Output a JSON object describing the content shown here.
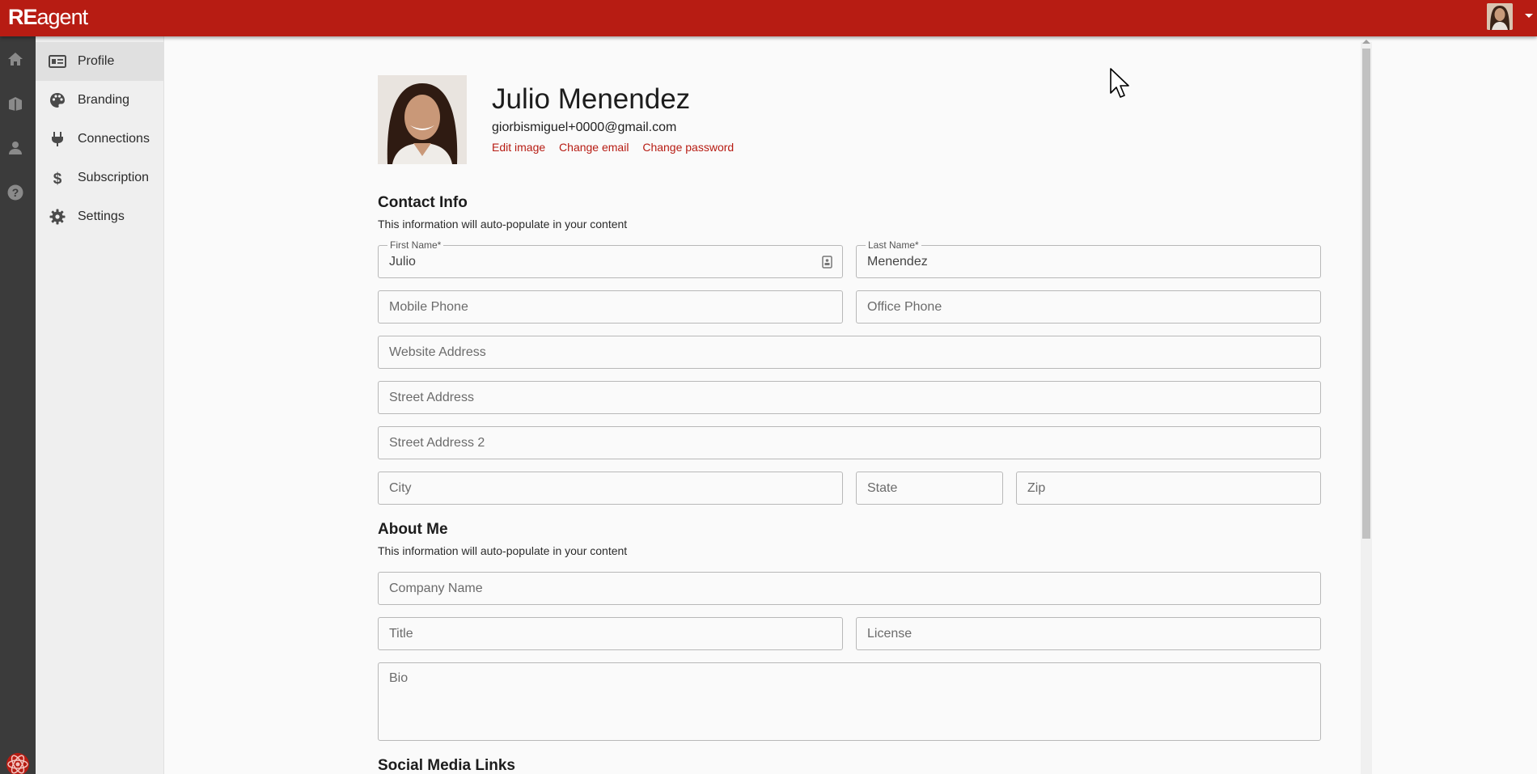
{
  "app": {
    "logo_bold": "RE",
    "logo_rest": "agent",
    "brand_color": "#b71c13"
  },
  "rail": {
    "icons": [
      "home-icon",
      "book-icon",
      "person-icon",
      "help-icon"
    ]
  },
  "sidebar": {
    "items": [
      {
        "label": "Profile",
        "icon": "id-card-icon",
        "active": true
      },
      {
        "label": "Branding",
        "icon": "palette-icon",
        "active": false
      },
      {
        "label": "Connections",
        "icon": "plug-icon",
        "active": false
      },
      {
        "label": "Subscription",
        "icon": "dollar-icon",
        "active": false
      },
      {
        "label": "Settings",
        "icon": "gear-icon",
        "active": false
      }
    ]
  },
  "profile": {
    "name": "Julio Menendez",
    "email": "giorbismiguel+0000@gmail.com",
    "links": {
      "edit_image": "Edit image",
      "change_email": "Change email",
      "change_password": "Change password"
    }
  },
  "contact": {
    "title": "Contact Info",
    "subtitle": "This information will auto-populate in your content",
    "first_name": {
      "label": "First Name*",
      "value": "Julio"
    },
    "last_name": {
      "label": "Last Name*",
      "value": "Menendez"
    },
    "mobile_phone": {
      "placeholder": "Mobile Phone"
    },
    "office_phone": {
      "placeholder": "Office Phone"
    },
    "website": {
      "placeholder": "Website Address"
    },
    "street": {
      "placeholder": "Street Address"
    },
    "street2": {
      "placeholder": "Street Address 2"
    },
    "city": {
      "placeholder": "City"
    },
    "state": {
      "placeholder": "State"
    },
    "zip": {
      "placeholder": "Zip"
    }
  },
  "about": {
    "title": "About Me",
    "subtitle": "This information will auto-populate in your content",
    "company": {
      "placeholder": "Company Name"
    },
    "job_title": {
      "placeholder": "Title"
    },
    "license": {
      "placeholder": "License"
    },
    "bio": {
      "placeholder": "Bio"
    }
  },
  "social": {
    "title": "Social Media Links"
  }
}
